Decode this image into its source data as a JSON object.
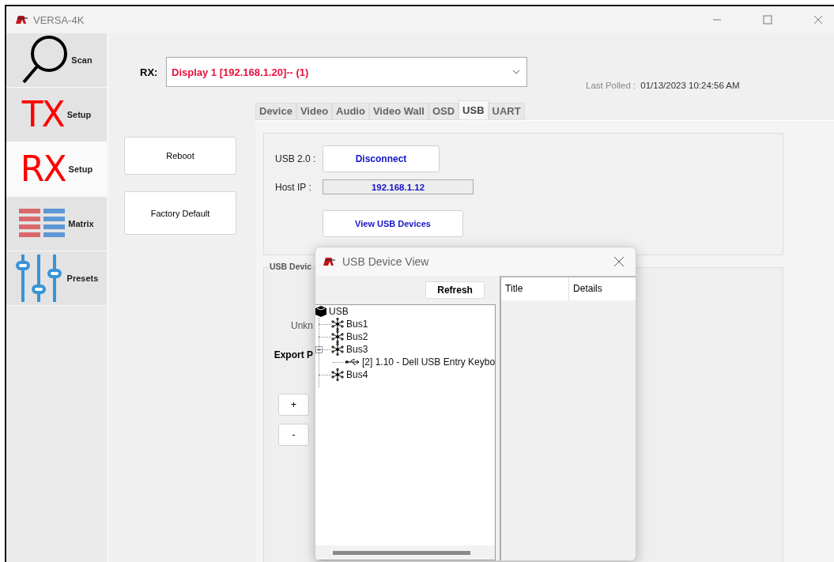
{
  "window": {
    "title": "VERSA-4K"
  },
  "sidebar": {
    "items": [
      {
        "kind": "scan",
        "label": "Scan",
        "selected": false
      },
      {
        "kind": "tx",
        "glyph": "TX",
        "label": "Setup",
        "selected": false
      },
      {
        "kind": "rx",
        "glyph": "RX",
        "label": "Setup",
        "selected": true
      },
      {
        "kind": "matrix",
        "label": "Matrix",
        "selected": false
      },
      {
        "kind": "presets",
        "label": "Presets",
        "selected": false
      }
    ]
  },
  "rx_selector": {
    "label": "RX:",
    "value": "Display 1 [192.168.1.20]-- (1)"
  },
  "last_polled": {
    "label": "Last Polled :",
    "value": "01/13/2023 10:24:56 AM"
  },
  "actions": [
    "Reboot",
    "Factory Default"
  ],
  "tabs": [
    {
      "label": "Device",
      "selected": false
    },
    {
      "label": "Video",
      "selected": false
    },
    {
      "label": "Audio",
      "selected": false
    },
    {
      "label": "Video Wall",
      "selected": false
    },
    {
      "label": "OSD",
      "selected": false
    },
    {
      "label": "USB",
      "selected": true
    },
    {
      "label": "UART",
      "selected": false
    }
  ],
  "usb": {
    "usb_label": "USB 2.0 :",
    "connect_button": "Disconnect",
    "host_ip_label": "Host IP :",
    "host_ip": "192.168.1.12",
    "view_button": "View USB Devices"
  },
  "usb_devices_group": {
    "title": "USB Devic",
    "text_1": "Unkn",
    "text_2": "Export P",
    "buttons": [
      "+",
      "-"
    ]
  },
  "dialog": {
    "title": "USB Device View",
    "refresh_button": "Refresh",
    "tree": [
      {
        "kind": "root",
        "label": "USB",
        "children": [
          {
            "kind": "bus",
            "label": "Bus1"
          },
          {
            "kind": "bus",
            "label": "Bus2"
          },
          {
            "kind": "bus",
            "label": "Bus3",
            "expanded": true,
            "children": [
              {
                "kind": "device",
                "label": "[2] 1.10 - Dell USB Entry Keybo"
              }
            ]
          },
          {
            "kind": "bus",
            "label": "Bus4"
          }
        ]
      }
    ],
    "columns": [
      "Title",
      "Details"
    ]
  }
}
